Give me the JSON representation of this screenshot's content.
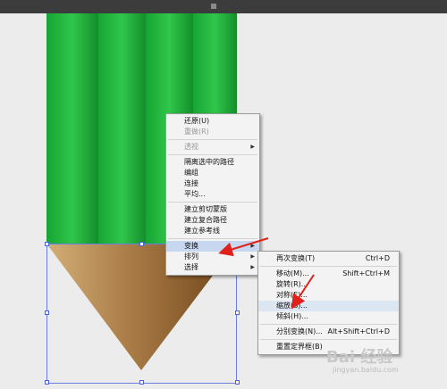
{
  "context_menu": {
    "items": [
      {
        "label": "还原(U)",
        "enabled": true
      },
      {
        "label": "重做(R)",
        "enabled": false
      },
      {
        "type": "separator"
      },
      {
        "label": "透视",
        "enabled": false,
        "submenu": true
      },
      {
        "type": "separator"
      },
      {
        "label": "隔离选中的路径",
        "enabled": true
      },
      {
        "label": "编组",
        "enabled": true
      },
      {
        "label": "连接",
        "enabled": true
      },
      {
        "label": "平均...",
        "enabled": true
      },
      {
        "type": "separator"
      },
      {
        "label": "建立剪切蒙版",
        "enabled": true
      },
      {
        "label": "建立复合路径",
        "enabled": true
      },
      {
        "label": "建立参考线",
        "enabled": true
      },
      {
        "type": "separator"
      },
      {
        "label": "变换",
        "enabled": true,
        "submenu": true,
        "active": true
      },
      {
        "label": "排列",
        "enabled": true,
        "submenu": true
      },
      {
        "label": "选择",
        "enabled": true,
        "submenu": true
      }
    ]
  },
  "transform_submenu": {
    "items": [
      {
        "label": "再次变换(T)",
        "shortcut": "Ctrl+D"
      },
      {
        "type": "separator"
      },
      {
        "label": "移动(M)...",
        "shortcut": "Shift+Ctrl+M"
      },
      {
        "label": "旋转(R)...",
        "shortcut": ""
      },
      {
        "label": "对称(E)...",
        "shortcut": ""
      },
      {
        "label": "缩放(S)...",
        "shortcut": "",
        "hover": true
      },
      {
        "label": "倾斜(H)...",
        "shortcut": ""
      },
      {
        "type": "separator"
      },
      {
        "label": "分别变换(N)...",
        "shortcut": "Alt+Shift+Ctrl+D"
      },
      {
        "type": "separator"
      },
      {
        "label": "重置定界框(B)",
        "shortcut": ""
      }
    ]
  },
  "watermark": {
    "text": "Bai 经验",
    "subtext": "jingyan.baidu.com"
  },
  "colors": {
    "canvas": "#ececec",
    "pencil_green_light": "#2fc24a",
    "pencil_green_dark": "#14922c",
    "pencil_wood_light": "#c7a16b",
    "pencil_wood_dark": "#7a4f23",
    "annotation_arrow": "#e0201b",
    "selection": "#4a62d8",
    "menu_active": "#c6d7ef"
  }
}
